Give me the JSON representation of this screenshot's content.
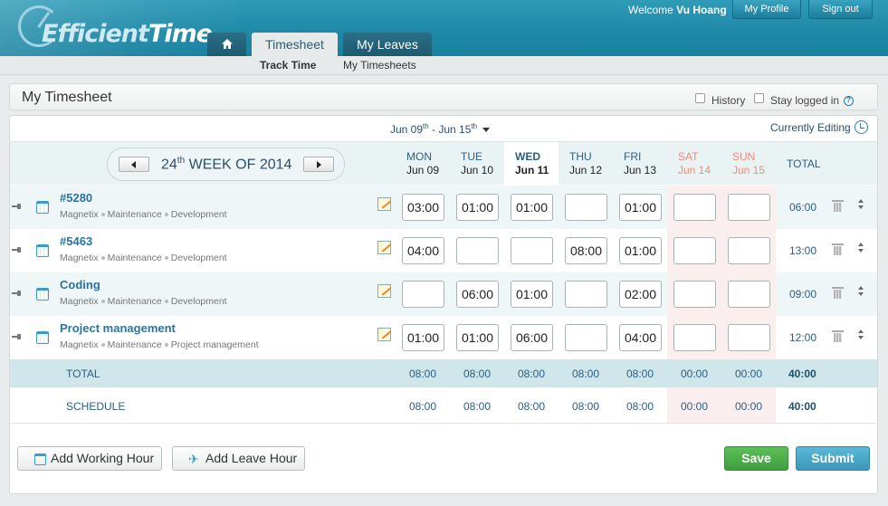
{
  "header": {
    "logo_part1": "Efficient",
    "logo_part2": "Time",
    "welcome_prefix": "Welcome",
    "user_name": "Vu Hoang",
    "my_profile": "My Profile",
    "sign_out": "Sign out",
    "tabs": [
      "Timesheet",
      "My Leaves"
    ],
    "subnav": [
      "Track Time",
      "My Timesheets"
    ]
  },
  "titlebar": {
    "title": "My Timesheet",
    "history_label": "History",
    "stay_logged_label": "Stay logged in",
    "help_glyph": "?"
  },
  "toolbar": {
    "range_start": "Jun 09",
    "range_start_sup": "th",
    "range_sep": " - Jun 15",
    "range_end_sup": "th",
    "currently_editing": "Currently Editing"
  },
  "week": {
    "label_num": "24",
    "label_sup": "th",
    "label_rest": " WEEK OF 2014"
  },
  "days": [
    {
      "name": "MON",
      "date": "Jun 09"
    },
    {
      "name": "TUE",
      "date": "Jun 10"
    },
    {
      "name": "WED",
      "date": "Jun 11"
    },
    {
      "name": "THU",
      "date": "Jun 12"
    },
    {
      "name": "FRI",
      "date": "Jun 13"
    },
    {
      "name": "SAT",
      "date": "Jun 14"
    },
    {
      "name": "SUN",
      "date": "Jun 15"
    }
  ],
  "total_header": "TOTAL",
  "tasks": [
    {
      "name": "#5280",
      "path": [
        "Magnetix",
        "Maintenance",
        "Development"
      ],
      "hours": [
        "03:00",
        "01:00",
        "01:00",
        "",
        "01:00",
        "",
        ""
      ],
      "total": "06:00"
    },
    {
      "name": "#5463",
      "path": [
        "Magnetix",
        "Maintenance",
        "Development"
      ],
      "hours": [
        "04:00",
        "",
        "",
        "08:00",
        "01:00",
        "",
        ""
      ],
      "total": "13:00"
    },
    {
      "name": "Coding",
      "path": [
        "Magnetix",
        "Maintenance",
        "Development"
      ],
      "hours": [
        "",
        "06:00",
        "01:00",
        "",
        "02:00",
        "",
        ""
      ],
      "total": "09:00"
    },
    {
      "name": "Project management",
      "path": [
        "Magnetix",
        "Maintenance",
        "Project management"
      ],
      "hours": [
        "01:00",
        "01:00",
        "06:00",
        "",
        "04:00",
        "",
        ""
      ],
      "total": "12:00"
    }
  ],
  "totals": {
    "label": "TOTAL",
    "values": [
      "08:00",
      "08:00",
      "08:00",
      "08:00",
      "08:00",
      "00:00",
      "00:00"
    ],
    "grand": "40:00"
  },
  "schedule": {
    "label": "SCHEDULE",
    "values": [
      "08:00",
      "08:00",
      "08:00",
      "08:00",
      "08:00",
      "00:00",
      "00:00"
    ],
    "grand": "40:00"
  },
  "actions": {
    "add_working_hour": "Add Working Hour",
    "add_leave_hour": "Add Leave Hour",
    "save": "Save",
    "submit": "Submit"
  },
  "colors": {
    "header_bg": "#1f8aa8",
    "accent": "#2a73a0",
    "weekend": "#f08a7a",
    "save": "#4cae4a",
    "submit": "#4aa8cb"
  }
}
